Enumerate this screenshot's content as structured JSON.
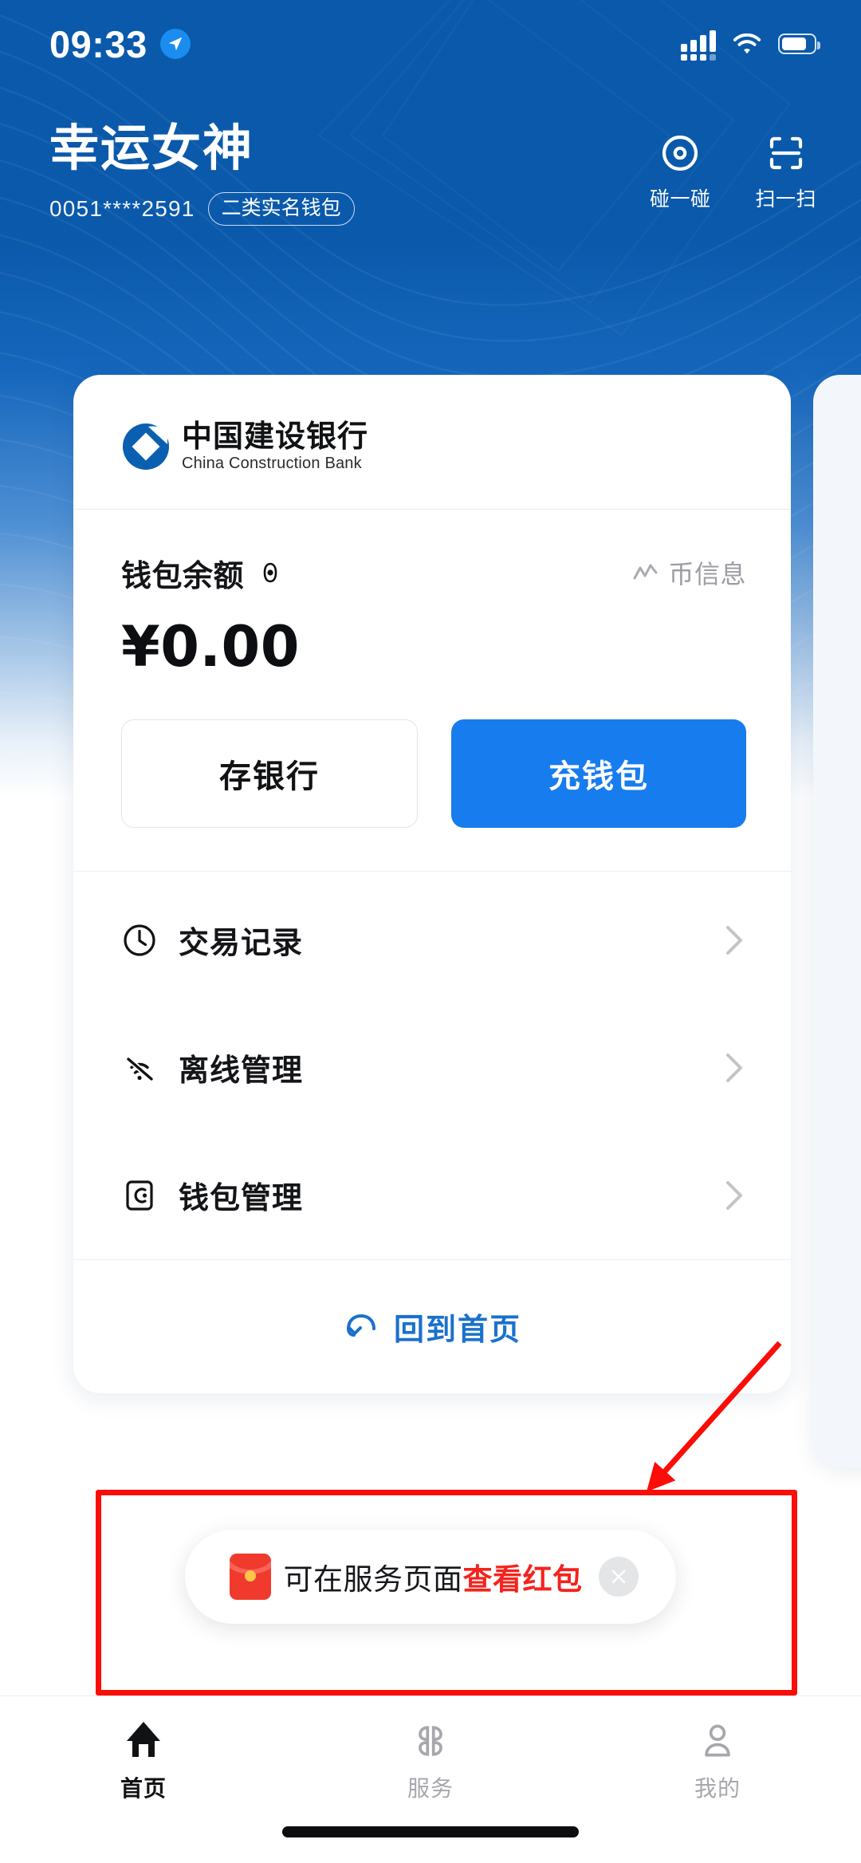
{
  "status_bar": {
    "time": "09:33",
    "location_icon": "location-arrow-icon",
    "signal_icon": "cellular-signal-icon",
    "wifi_icon": "wifi-icon",
    "battery_icon": "battery-icon"
  },
  "header": {
    "account_name": "幸运女神",
    "account_number": "0051****2591",
    "account_tag": "二类实名钱包",
    "actions": [
      {
        "label": "碰一碰",
        "icon": "nfc-tap-icon"
      },
      {
        "label": "扫一扫",
        "icon": "scan-qr-icon"
      }
    ]
  },
  "card": {
    "bank_name_cn": "中国建设银行",
    "bank_name_en": "China Construction Bank",
    "bank_logo_icon": "ccb-logo-icon",
    "balance_label": "钱包余额",
    "balance_eye_icon": "eye-icon",
    "coin_info_label": "币信息",
    "coin_info_icon": "trend-line-icon",
    "balance_amount": "¥0.00",
    "buttons": {
      "deposit_label": "存银行",
      "topup_label": "充钱包"
    },
    "menu": [
      {
        "label": "交易记录",
        "icon": "clock-icon",
        "chevron": "chevron-right-icon"
      },
      {
        "label": "离线管理",
        "icon": "wifi-off-icon",
        "chevron": "chevron-right-icon"
      },
      {
        "label": "钱包管理",
        "icon": "wallet-icon",
        "chevron": "chevron-right-icon"
      }
    ],
    "home_link": {
      "label": "回到首页",
      "icon": "flip-back-icon"
    }
  },
  "toast": {
    "icon": "red-envelope-icon",
    "text_normal": "可在服务页面",
    "text_highlight": "查看红包",
    "close_icon": "close-icon"
  },
  "annotation": {
    "box_color": "#fb0d08",
    "arrow_color": "#fb0d08",
    "arrow_icon": "pointer-arrow-icon"
  },
  "tabbar": {
    "items": [
      {
        "label": "首页",
        "icon": "home-icon",
        "active": true
      },
      {
        "label": "服务",
        "icon": "grid-apps-icon",
        "active": false
      },
      {
        "label": "我的",
        "icon": "person-icon",
        "active": false
      }
    ]
  },
  "colors": {
    "header_blue": "#0a59ab",
    "primary_blue": "#177ced",
    "link_blue": "#1a71cd",
    "highlight_red": "#f4231d",
    "annotation_red": "#fb0d08"
  }
}
